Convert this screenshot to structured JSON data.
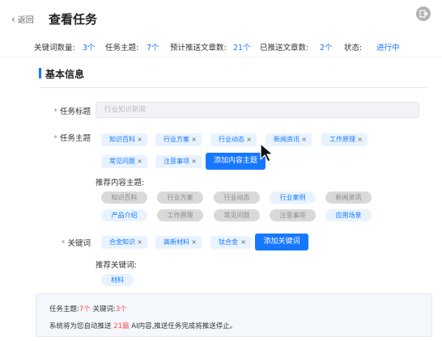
{
  "header": {
    "back_label": "返回",
    "back_chevron": "‹",
    "title": "查看任务",
    "exit_icon": "exit-icon"
  },
  "stats": {
    "keyword_count_label": "关键词数量:",
    "keyword_count_value": "3个",
    "topic_label": "任务主题:",
    "topic_value": "7个",
    "planned_label": "预计推送文章数:",
    "planned_value": "21个",
    "pushed_label": "已推送文章数:",
    "pushed_value": "2个",
    "status_label": "状态:",
    "status_value": "进行中"
  },
  "section": {
    "title": "基本信息"
  },
  "form": {
    "task_title_label": "任务标题",
    "task_title_placeholder": "行业知识新闻",
    "task_topic_label": "任务主题",
    "topic_tags": [
      "知识百科",
      "行业方案",
      "行业动态",
      "新闻资讯",
      "工作原理",
      "常见问题",
      "注意事项"
    ],
    "add_topic_button": "添加内容主题",
    "recommended_topics_label": "推荐内容主题:",
    "recommended_topics": [
      {
        "label": "知识百科",
        "state": "used"
      },
      {
        "label": "行业方案",
        "state": "used"
      },
      {
        "label": "行业动态",
        "state": "used"
      },
      {
        "label": "行业案例",
        "state": "free"
      },
      {
        "label": "新闻资讯",
        "state": "used"
      },
      {
        "label": "产品介绍",
        "state": "free"
      },
      {
        "label": "工作原理",
        "state": "used"
      },
      {
        "label": "常见问题",
        "state": "used"
      },
      {
        "label": "注意事项",
        "state": "used"
      },
      {
        "label": "应用场景",
        "state": "free"
      }
    ],
    "keyword_label": "关键词",
    "keyword_tags": [
      "合金知识",
      "高新材料",
      "钛合金"
    ],
    "add_keyword_button": "添加关键词",
    "recommended_keywords_label": "推荐关键词:",
    "recommended_keywords": [
      "材料"
    ],
    "close_symbol": "×",
    "required_mark": "*"
  },
  "summary": {
    "topic_prefix": "任务主题:",
    "topic_count": "7个",
    "keyword_prefix": "关键词:",
    "keyword_count": "3个",
    "push_prefix": "系统将为您自动推送",
    "push_count": "21篇",
    "push_suffix": "AI内容,推送任务完成将推送停止。"
  },
  "colors": {
    "accent": "#1677ff",
    "tag_bg": "#e8f3ff",
    "used_pill_bg": "#d9d9d9",
    "highlight": "#ff4d4f"
  }
}
